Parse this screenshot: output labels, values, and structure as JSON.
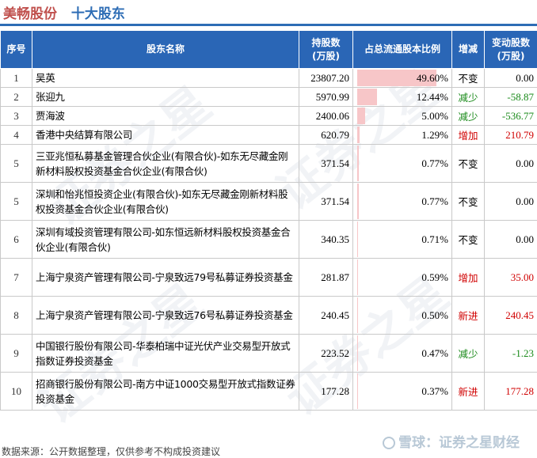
{
  "title": {
    "company": "美畅股份",
    "heading": "十大股东"
  },
  "columns": [
    "序号",
    "股东名称",
    "持股数\n(万股)",
    "占总流通股本比例",
    "增减",
    "变动股数\n(万股)"
  ],
  "rows": [
    {
      "idx": "1",
      "name": "吴英",
      "shares": "23807.20",
      "ratio": 49.6,
      "ratio_label": "49.60%",
      "change": "不变",
      "change_color": "#000000",
      "delta": "0.00"
    },
    {
      "idx": "2",
      "name": "张迎九",
      "shares": "5970.99",
      "ratio": 12.44,
      "ratio_label": "12.44%",
      "change": "减少",
      "change_color": "#1a8a1a",
      "delta": "-58.87"
    },
    {
      "idx": "3",
      "name": "贾海波",
      "shares": "2400.06",
      "ratio": 5.0,
      "ratio_label": "5.00%",
      "change": "减少",
      "change_color": "#1a8a1a",
      "delta": "-536.77"
    },
    {
      "idx": "4",
      "name": "香港中央结算有限公司",
      "shares": "620.79",
      "ratio": 1.29,
      "ratio_label": "1.29%",
      "change": "增加",
      "change_color": "#d00000",
      "delta": "210.79"
    },
    {
      "idx": "5",
      "name": "三亚兆恒私募基金管理合伙企业(有限合伙)-如东无尽藏金刚新材料股权投资基金合伙企业(有限合伙)",
      "shares": "371.54",
      "ratio": 0.77,
      "ratio_label": "0.77%",
      "change": "不变",
      "change_color": "#000000",
      "delta": "0.00"
    },
    {
      "idx": "5",
      "name": "深圳和怡兆恒投资企业(有限合伙)-如东无尽藏金刚新材料股权投资基金合伙企业(有限合伙)",
      "shares": "371.54",
      "ratio": 0.77,
      "ratio_label": "0.77%",
      "change": "不变",
      "change_color": "#000000",
      "delta": "0.00"
    },
    {
      "idx": "6",
      "name": "深圳有域投资管理有限公司-如东恒远新材料股权投资基金合伙企业(有限合伙)",
      "shares": "340.35",
      "ratio": 0.71,
      "ratio_label": "0.71%",
      "change": "不变",
      "change_color": "#000000",
      "delta": "0.00"
    },
    {
      "idx": "7",
      "name": "上海宁泉资产管理有限公司-宁泉致远79号私募证券投资基金",
      "shares": "281.87",
      "ratio": 0.59,
      "ratio_label": "0.59%",
      "change": "增加",
      "change_color": "#d00000",
      "delta": "35.00"
    },
    {
      "idx": "8",
      "name": "上海宁泉资产管理有限公司-宁泉致远76号私募证券投资基金",
      "shares": "240.45",
      "ratio": 0.5,
      "ratio_label": "0.50%",
      "change": "新进",
      "change_color": "#d00000",
      "delta": "240.45"
    },
    {
      "idx": "9",
      "name": "中国银行股份有限公司-华泰柏瑞中证光伏产业交易型开放式指数证券投资基金",
      "shares": "223.52",
      "ratio": 0.47,
      "ratio_label": "0.47%",
      "change": "减少",
      "change_color": "#1a8a1a",
      "delta": "-1.23"
    },
    {
      "idx": "10",
      "name": "招商银行股份有限公司-南方中证1000交易型开放式指数证券投资基金",
      "shares": "177.28",
      "ratio": 0.37,
      "ratio_label": "0.37%",
      "change": "新进",
      "change_color": "#d00000",
      "delta": "177.28"
    }
  ],
  "footer": "数据来源：公开数据整理，仅供参考不构成投资建议",
  "watermark": "雪球：证券之星财经",
  "background_watermark": "证券之星"
}
